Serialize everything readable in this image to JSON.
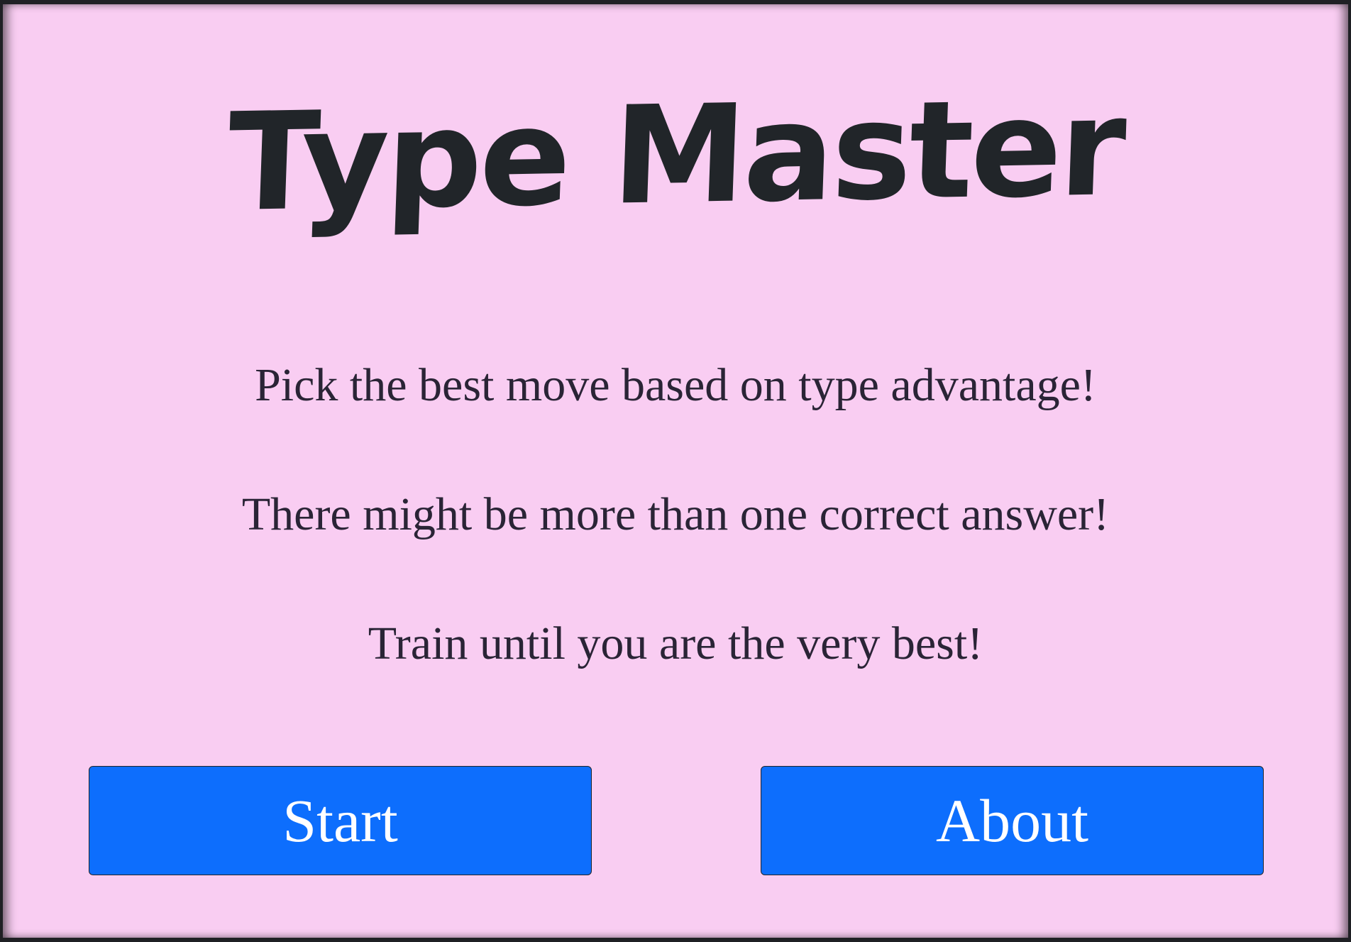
{
  "app": {
    "title": "Type Master"
  },
  "intro": {
    "line1": "Pick the best move based on type advantage!",
    "line2": "There might be more than one correct answer!",
    "line3": "Train until you are the very best!"
  },
  "buttons": {
    "start_label": "Start",
    "about_label": "About"
  },
  "colors": {
    "background": "#f9cdf2",
    "button": "#0d6efd",
    "text": "#212529"
  }
}
